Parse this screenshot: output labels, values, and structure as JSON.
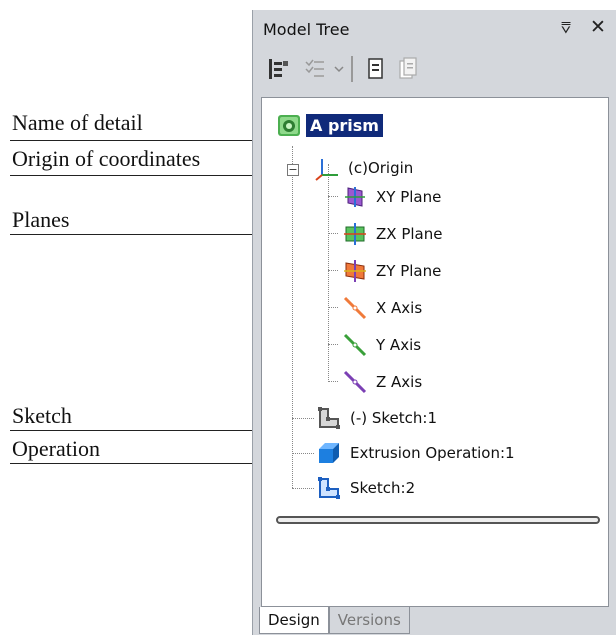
{
  "panel": {
    "title": "Model Tree",
    "pin_symbol": "⩢",
    "close_symbol": "✕"
  },
  "toolbar": {
    "buttons": [
      "tree-structure-icon",
      "checklist-dropdown-icon",
      "document-icon",
      "document-copy-icon"
    ]
  },
  "tree": {
    "root": {
      "label": "A prism",
      "icon": "prism-part-icon"
    },
    "origin": {
      "label": "(c)Origin",
      "icon": "origin-axes-icon",
      "expander": "−"
    },
    "children": [
      {
        "label": "XY Plane",
        "icon": "xy-plane-icon",
        "color": "#7a3fb0"
      },
      {
        "label": "ZX Plane",
        "icon": "zx-plane-icon",
        "color": "#2f9d3a"
      },
      {
        "label": "ZY Plane",
        "icon": "zy-plane-icon",
        "color": "#d9431b"
      },
      {
        "label": "X Axis",
        "icon": "x-axis-icon",
        "color": "#f07a3a"
      },
      {
        "label": "Y Axis",
        "icon": "y-axis-icon",
        "color": "#3aa03a"
      },
      {
        "label": "Z Axis",
        "icon": "z-axis-icon",
        "color": "#7b3fb4"
      }
    ],
    "sketch1": {
      "label": "(-) Sketch:1",
      "icon": "sketch-icon"
    },
    "extrusion": {
      "label": "Extrusion Operation:1",
      "icon": "extrusion-cube-icon"
    },
    "sketch2": {
      "label": "Sketch:2",
      "icon": "sketch-blue-icon"
    }
  },
  "tabs": [
    {
      "label": "Design",
      "active": true
    },
    {
      "label": "Versions",
      "active": false
    }
  ],
  "callouts": {
    "name_of_detail": "Name of detail",
    "origin": "Origin of coordinates",
    "planes": "Planes",
    "sketch": "Sketch",
    "operation": "Operation"
  }
}
